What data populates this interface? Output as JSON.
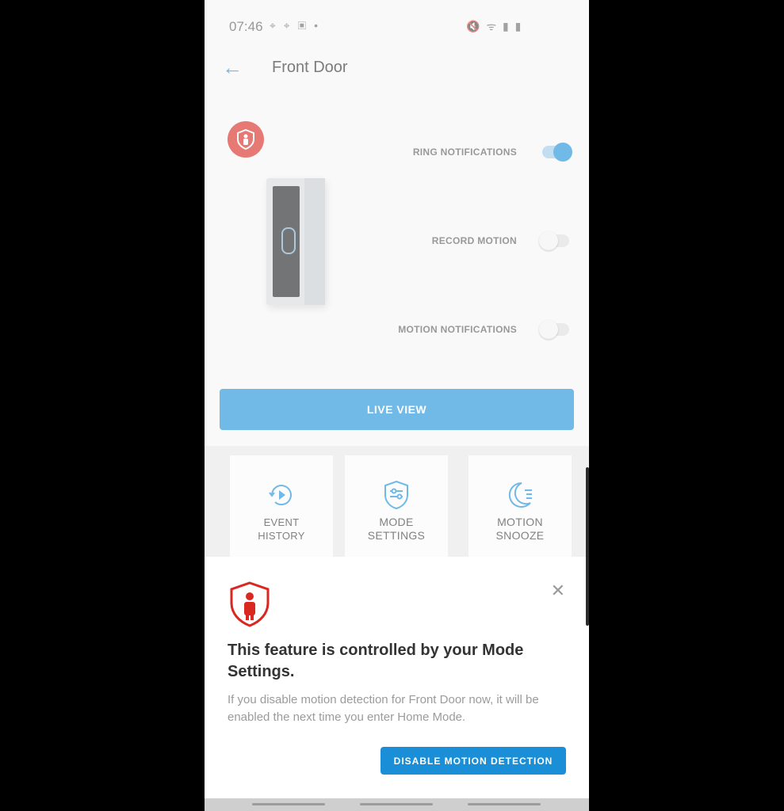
{
  "status_bar": {
    "time": "07:46",
    "left_icons": "⌖ ⌖ ▣ •",
    "right_icons": "🔇 ᯤ ▮ ▮"
  },
  "header": {
    "back_icon": "arrow-left-icon",
    "title": "Front Door"
  },
  "device": {
    "badge_icon": "shield-person-icon",
    "image": "doorbell-image"
  },
  "toggles": [
    {
      "label": "RING NOTIFICATIONS",
      "state": "on"
    },
    {
      "label": "RECORD MOTION",
      "state": "off"
    },
    {
      "label": "MOTION NOTIFICATIONS",
      "state": "off"
    }
  ],
  "live_view_label": "LIVE VIEW",
  "tiles": [
    {
      "icon": "history-play-icon",
      "line1": "EVENT",
      "line2": "HISTORY"
    },
    {
      "icon": "mode-settings-icon",
      "line1": "MODE",
      "line2": "SETTINGS"
    },
    {
      "icon": "moon-snooze-icon",
      "line1": "MOTION",
      "line2": "SNOOZE"
    }
  ],
  "sheet": {
    "icon": "shield-person-icon",
    "close_icon": "close-icon",
    "title": "This feature is controlled by your Mode Settings.",
    "body": "If you disable motion detection for Front Door now, it will be enabled the next time you enter Home Mode.",
    "button": "DISABLE MOTION DETECTION"
  },
  "colors": {
    "accent": "#1a8fd8",
    "alert": "#d9281f"
  }
}
